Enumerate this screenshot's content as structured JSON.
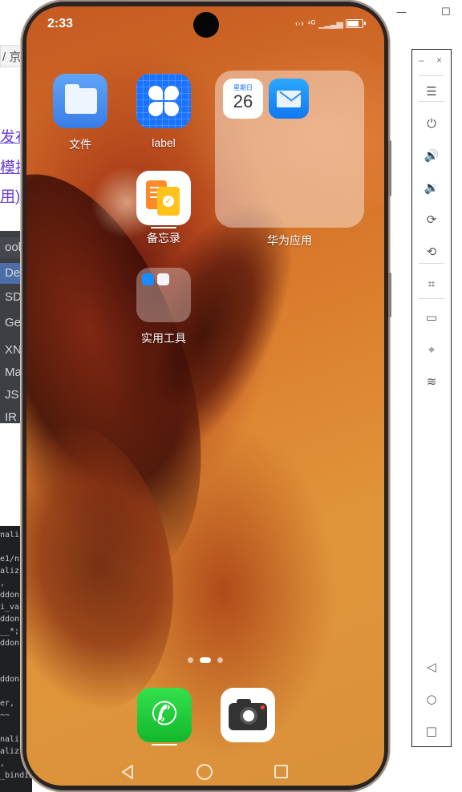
{
  "host": {
    "minimize_glyph": "—",
    "maximize_glyph": "☐",
    "breadcrumb": "/ 京",
    "links": [
      "发布",
      "模拟",
      "用)"
    ],
    "tree_items": [
      "ools",
      "De",
      "SD",
      "Ge",
      "XN",
      "Ma",
      "JS",
      "IR"
    ],
    "code_lines": [
      "nali",
      "",
      "e1/n",
      "aliz",
      ",",
      "ddon",
      "i_va",
      "ddon",
      "__*;",
      "ddon",
      "",
      "",
      "ddon",
      "",
      "er,",
      "~~",
      "",
      "nali",
      "aliz",
      ",",
      "_bindin"
    ]
  },
  "status_bar": {
    "time": "2:33",
    "signal_text": "⁴ᴳ",
    "battery_level": 0.85
  },
  "apps": [
    {
      "id": "files",
      "label": "文件",
      "icon": "folder-icon"
    },
    {
      "id": "label",
      "label": "label",
      "icon": "flower-grid-icon"
    },
    {
      "id": "memo",
      "label": "备忘录",
      "icon": "memo-icon"
    },
    {
      "id": "tools",
      "label": "实用工具",
      "icon": "tools-folder-icon"
    }
  ],
  "big_folder": {
    "label": "华为应用",
    "calendar_weekday": "星期日",
    "calendar_day": "26",
    "apps": [
      "calendar-icon",
      "mail-icon"
    ]
  },
  "pager": {
    "pages": 3,
    "current": 2
  },
  "dock": [
    {
      "id": "phone",
      "icon": "phone-icon",
      "glyph": "✆"
    },
    {
      "id": "camera",
      "icon": "camera-icon"
    }
  ],
  "nav": [
    "back-icon",
    "home-icon",
    "recents-icon"
  ],
  "toolbar": {
    "close_glyph": "×",
    "minimize_glyph": "–",
    "items": [
      {
        "name": "menu-icon",
        "glyph": "☰"
      },
      {
        "name": "power-icon",
        "glyph": "⏻"
      },
      {
        "name": "volume-up-icon",
        "glyph": "🔊"
      },
      {
        "name": "volume-down-icon",
        "glyph": "🔉"
      },
      {
        "name": "rotate-icon",
        "glyph": "⟳"
      },
      {
        "name": "rotate-back-icon",
        "glyph": "⟲"
      },
      {
        "name": "screenshot-crop-icon",
        "glyph": "⌗"
      },
      {
        "name": "battery-icon",
        "glyph": "▭"
      },
      {
        "name": "location-icon",
        "glyph": "⌖"
      },
      {
        "name": "wifi-icon",
        "glyph": "≋"
      },
      {
        "name": "nav-back-icon",
        "glyph": "◁"
      },
      {
        "name": "nav-home-icon",
        "glyph": "○"
      },
      {
        "name": "nav-recents-icon",
        "glyph": "□"
      }
    ]
  },
  "colors": {
    "accent_blue": "#1a73ff",
    "wallpaper_orange": "#d97a2c",
    "dock_phone_green": "#12b82c"
  }
}
